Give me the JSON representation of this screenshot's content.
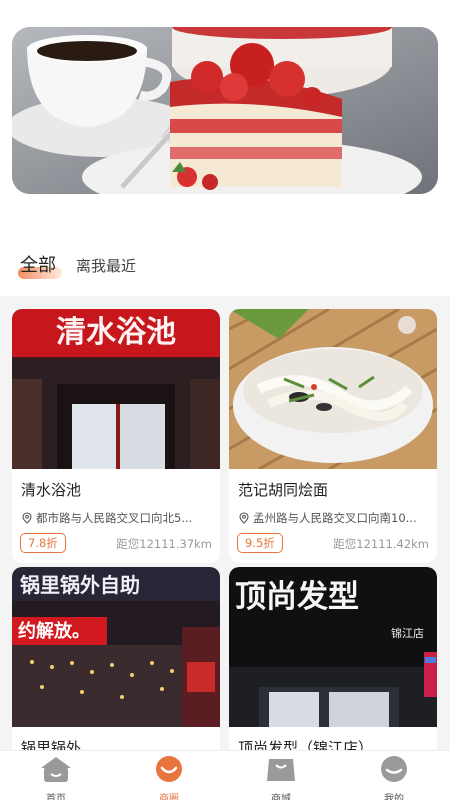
{
  "tabs": {
    "all": "全部",
    "nearest": "离我最近"
  },
  "cards": [
    {
      "name": "清水浴池",
      "address": "都市路与人民路交叉口向北5...",
      "discount": "7.8折",
      "distance": "距您12111.37km",
      "sign_text": "清水浴池"
    },
    {
      "name": "范记胡同烩面",
      "address": "孟州路与人民路交叉口向南10...",
      "discount": "9.5折",
      "distance": "距您12111.42km"
    },
    {
      "name": "锅里锅外",
      "address": "",
      "discount": "",
      "distance": "",
      "sign_text": "锅里锅外自助",
      "sign_text2": "约解放。"
    },
    {
      "name": "顶尚发型（锦江店）",
      "address": "",
      "discount": "",
      "distance": "",
      "sign_text": "顶尚发型",
      "sign_sub": "锦江店"
    }
  ],
  "nav": [
    {
      "label": "首页",
      "icon": "home-icon"
    },
    {
      "label": "商圈",
      "icon": "smile-icon"
    },
    {
      "label": "商城",
      "icon": "shopping-bag-icon"
    },
    {
      "label": "我的",
      "icon": "profile-icon"
    }
  ],
  "colors": {
    "accent": "#e8743e",
    "nav_inactive": "#9a9a9a"
  }
}
